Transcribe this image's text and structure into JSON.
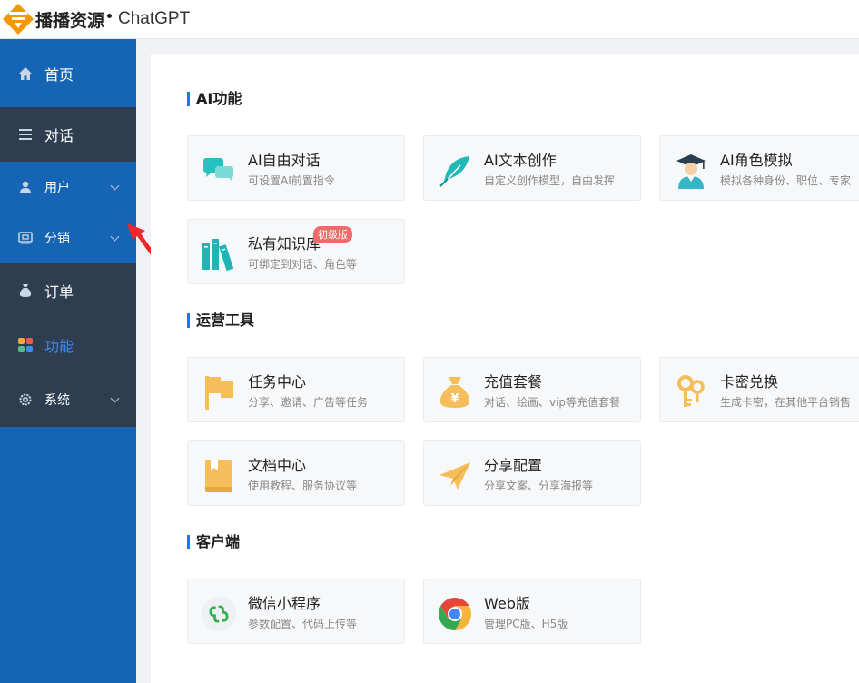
{
  "header": {
    "brand": "播播资源",
    "app_name": "ChatGPT"
  },
  "sidebar": {
    "items": [
      {
        "label": "首页",
        "icon": "home-icon"
      },
      {
        "label": "对话",
        "icon": "list-icon"
      },
      {
        "label": "用户",
        "icon": "user-icon"
      },
      {
        "label": "分销",
        "icon": "distribution-icon"
      },
      {
        "label": "订单",
        "icon": "money-bag-icon"
      },
      {
        "label": "功能",
        "icon": "grid-icon"
      },
      {
        "label": "系统",
        "icon": "gear-icon"
      }
    ]
  },
  "sections": [
    {
      "title": "AI功能",
      "cards": [
        {
          "title": "AI自由对话",
          "desc": "可设置AI前置指令",
          "icon": "chat-bubbles-icon"
        },
        {
          "title": "AI文本创作",
          "desc": "自定义创作模型，自由发挥",
          "icon": "feather-icon"
        },
        {
          "title": "AI角色模拟",
          "desc": "模拟各种身份、职位、专家",
          "icon": "graduate-icon"
        },
        {
          "title": "私有知识库",
          "desc": "可绑定到对话、角色等",
          "icon": "books-icon",
          "badge": "初级版"
        }
      ]
    },
    {
      "title": "运营工具",
      "cards": [
        {
          "title": "任务中心",
          "desc": "分享、邀请、广告等任务",
          "icon": "flag-icon"
        },
        {
          "title": "充值套餐",
          "desc": "对话、绘画、vip等充值套餐",
          "icon": "money-bag-icon"
        },
        {
          "title": "卡密兑换",
          "desc": "生成卡密，在其他平台销售",
          "icon": "keys-icon"
        },
        {
          "title": "文档中心",
          "desc": "使用教程、服务协议等",
          "icon": "document-icon"
        },
        {
          "title": "分享配置",
          "desc": "分享文案、分享海报等",
          "icon": "paper-plane-icon"
        }
      ]
    },
    {
      "title": "客户端",
      "cards": [
        {
          "title": "微信小程序",
          "desc": "参数配置、代码上传等",
          "icon": "mini-program-icon"
        },
        {
          "title": "Web版",
          "desc": "管理PC版、H5版",
          "icon": "chrome-icon"
        }
      ]
    }
  ],
  "colors": {
    "sidebar": "#1565b4",
    "sidebar_dark": "#2e3d50",
    "accent": "#1677ff",
    "badge": "#f16a6a"
  }
}
